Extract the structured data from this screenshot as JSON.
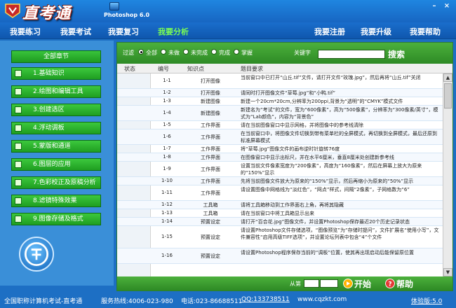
{
  "window": {
    "app_title": "直考通",
    "subtitle": "Photoshop 6.0",
    "min_glyph": "–",
    "close_glyph": "×"
  },
  "menu": {
    "items": [
      "我要练习",
      "我要考试",
      "我要复习",
      "我要分析"
    ],
    "right_items": [
      "我要注册",
      "我要升级",
      "我要帮助"
    ]
  },
  "sidebar": {
    "header": "全部章节",
    "chapters": [
      "1.基础知识",
      "2.绘图和编辑工具",
      "3.创建选区",
      "4.浮动调板",
      "5.蒙版和通道",
      "6.图层的应用",
      "7.色彩校正及原稿分析",
      "8.滤镜特殊效果",
      "9.图像存储及格式"
    ]
  },
  "filter": {
    "label": "过滤",
    "options": [
      "全部",
      "未做",
      "未完成",
      "完成",
      "掌握"
    ],
    "selected": "全部",
    "keyword_label": "关键字",
    "search_label": "搜索"
  },
  "table": {
    "headers": [
      "状态",
      "编号",
      "知识点",
      "题目要求"
    ],
    "rows": [
      {
        "num": "1-1",
        "kp": "打开图像",
        "q": "当前窗口中已打开“山丘.tif”文件，请打开文件“玫瑰.jpg”，然后再将“山丘.tif”关闭"
      },
      {
        "num": "1-2",
        "kp": "打开图像",
        "q": "请同时打开图像文件“草莓.jpg”和“小鸭.tif”"
      },
      {
        "num": "1-3",
        "kp": "新建图像",
        "q": "新建一个20cm*20cm,分辨率为200ppi,背景为“透明”的“CMYK”模式文件"
      },
      {
        "num": "1-4",
        "kp": "新建图像",
        "q": "新建名为“考试”的文件，宽为“600像素”，高为“500像素”，分辨率为“300像素/英寸”，模式为“Lab颜色”，内容为“背景色”"
      },
      {
        "num": "1-5",
        "kp": "工作界面",
        "q": "请在当前图像窗口中显示网格，并将图像中的参考线清除"
      },
      {
        "num": "1-6",
        "kp": "工作界面",
        "q": "在当前窗口中，将图像文件切换到带有菜单栏的全屏模式，再切换到全屏模式，最后还原到标准屏幕模式"
      },
      {
        "num": "1-7",
        "kp": "工作界面",
        "q": "将“草莓.jpg”图像文件的画布逆时针旋转76度"
      },
      {
        "num": "1-8",
        "kp": "工作界面",
        "q": "在图像窗口中显示出标尺，并在水平6厘米，垂直8厘米处创建新参考线"
      },
      {
        "num": "1-9",
        "kp": "工作界面",
        "q": "设置当前文件像素宽度为“200像素”，高度为“160像素”，然后在屏幕上放大为原来的“150%”显示"
      },
      {
        "num": "1-10",
        "kp": "工作界面",
        "q": "先将当前图像文件放大为原来的“150%”显示，然后再缩小为原来的“50%”显示"
      },
      {
        "num": "1-11",
        "kp": "工作界面",
        "q": "请设置图像中网格线为“淡红色”，“网点”样式，间隔“2像素”，子网格数为“6”"
      },
      {
        "num": "1-12",
        "kp": "工具箱",
        "q": "请将工具箱移动到工作界面右上角，再将其隐藏"
      },
      {
        "num": "1-13",
        "kp": "工具箱",
        "q": "请在当前窗口中将工具箱显示出来"
      },
      {
        "num": "1-14",
        "kp": "预置设定",
        "q": "请打开“百合花.jpg”图像文件，并设置Photoshop保存最近20个历史记录状态"
      },
      {
        "num": "1-15",
        "kp": "预置设定",
        "q": "请设置Photoshop文件存储选项，“图像预览”为“存储时提问”，文件扩展名“使用小写”，文件兼容性“启用高级TIFF选项”，并设置论坛列表中包含“4”个文件"
      },
      {
        "num": "1-16",
        "kp": "预置设定",
        "q": "请设置Photoshop程序保存当前的“调板”位置，使其再出现启动后能保留原位置"
      }
    ]
  },
  "bottom": {
    "from_label": "从第",
    "start_label": "开始",
    "help_label": "帮助"
  },
  "status": {
    "left": "全国职称计算机考试-直考通",
    "hotline": "服务热线:4006-023-980",
    "phone": "电话:023-86688511",
    "qq": "QQ:133738511",
    "url": "www.cqzkt.com",
    "version": "体验版:5.0"
  },
  "colors": {
    "accent_green": "#2e8a25",
    "active_menu": "#7cff52",
    "frame_blue": "#1d6fc4"
  }
}
